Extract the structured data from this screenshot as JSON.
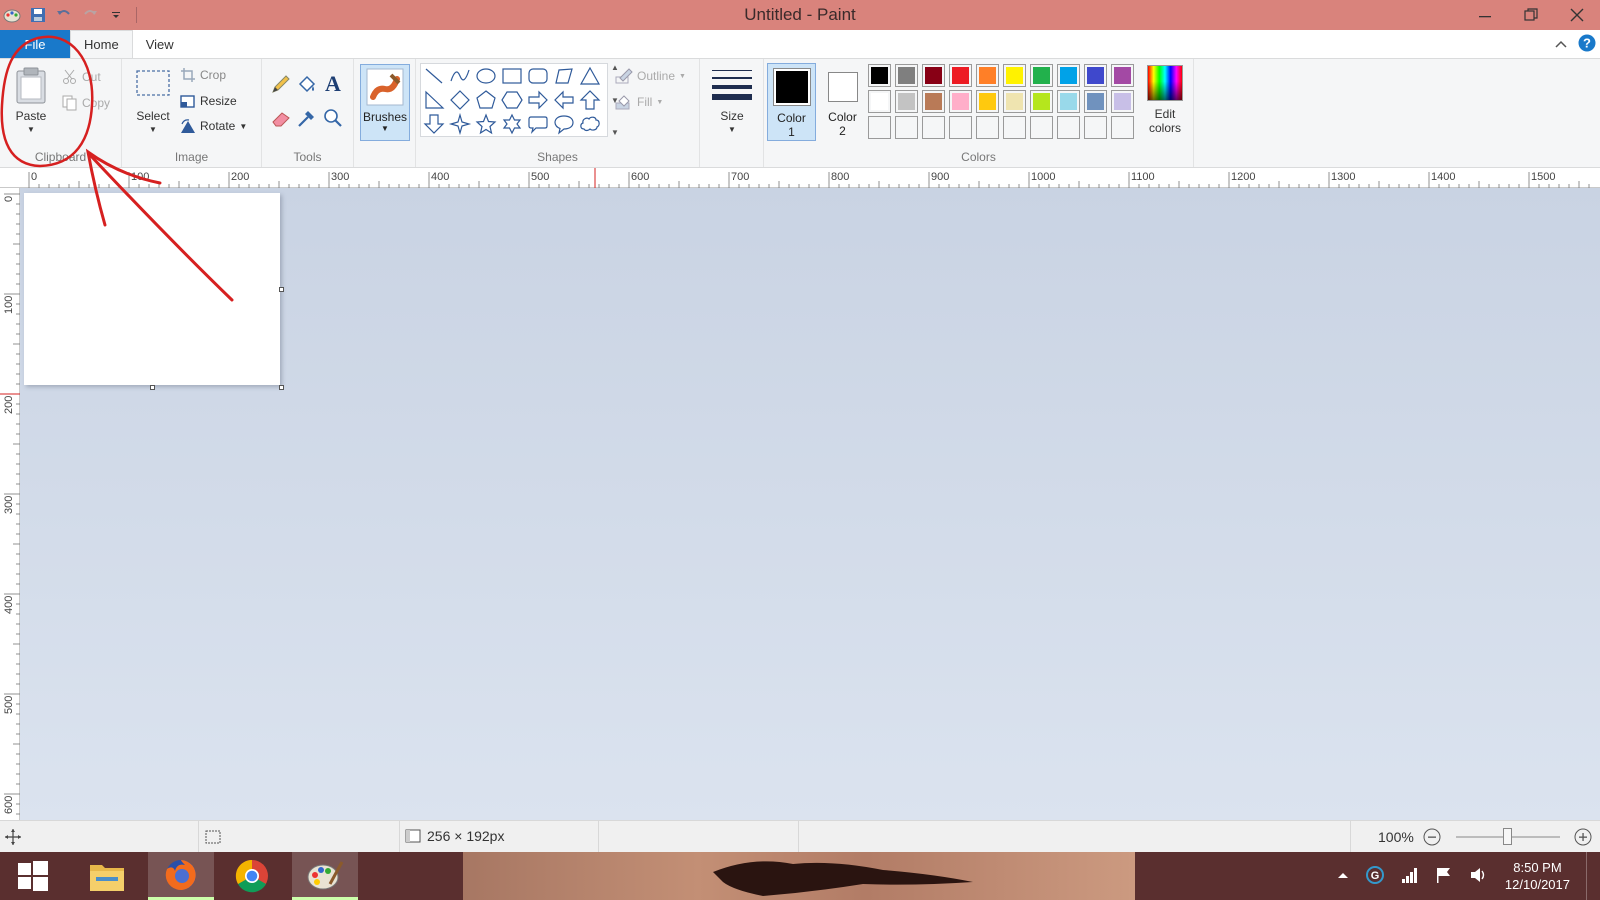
{
  "window": {
    "title": "Untitled - Paint"
  },
  "tabs": {
    "file": "File",
    "home": "Home",
    "view": "View"
  },
  "ribbon": {
    "clipboard": {
      "label": "Clipboard",
      "paste": "Paste",
      "cut": "Cut",
      "copy": "Copy"
    },
    "image": {
      "label": "Image",
      "select": "Select",
      "crop": "Crop",
      "resize": "Resize",
      "rotate": "Rotate"
    },
    "tools": {
      "label": "Tools"
    },
    "brushes": {
      "label": "Brushes"
    },
    "shapes": {
      "label": "Shapes",
      "outline": "Outline",
      "fill": "Fill"
    },
    "size": {
      "label": "Size"
    },
    "colors": {
      "label": "Colors",
      "color1": "Color",
      "color1_num": "1",
      "color2": "Color",
      "color2_num": "2",
      "edit1": "Edit",
      "edit2": "colors",
      "color1_value": "#000000",
      "color2_value": "#ffffff",
      "palette_row1": [
        "#000000",
        "#7f7f7f",
        "#880015",
        "#ed1c24",
        "#ff7f27",
        "#fff200",
        "#22b14c",
        "#00a2e8",
        "#3f48cc",
        "#a349a4"
      ],
      "palette_row2": [
        "#ffffff",
        "#c3c3c3",
        "#b97a57",
        "#ffaec9",
        "#ffc90e",
        "#efe4b0",
        "#b5e61d",
        "#99d9ea",
        "#7092be",
        "#c8bfe7"
      ],
      "palette_row3": [
        "#f5f6f7",
        "#f5f6f7",
        "#f5f6f7",
        "#f5f6f7",
        "#f5f6f7",
        "#f5f6f7",
        "#f5f6f7",
        "#f5f6f7",
        "#f5f6f7",
        "#f5f6f7"
      ]
    }
  },
  "rulers": {
    "h_ticks": [
      "0",
      "100",
      "200",
      "300",
      "400",
      "500",
      "600",
      "700",
      "800",
      "900",
      "1000",
      "1100",
      "1200",
      "1300",
      "1400",
      "1500"
    ],
    "v_ticks": [
      "0",
      "100",
      "200",
      "300",
      "400",
      "500",
      "600"
    ]
  },
  "status": {
    "dimensions": "256 × 192px",
    "zoom": "100%"
  },
  "taskbar": {
    "time": "8:50 PM",
    "date": "12/10/2017"
  }
}
